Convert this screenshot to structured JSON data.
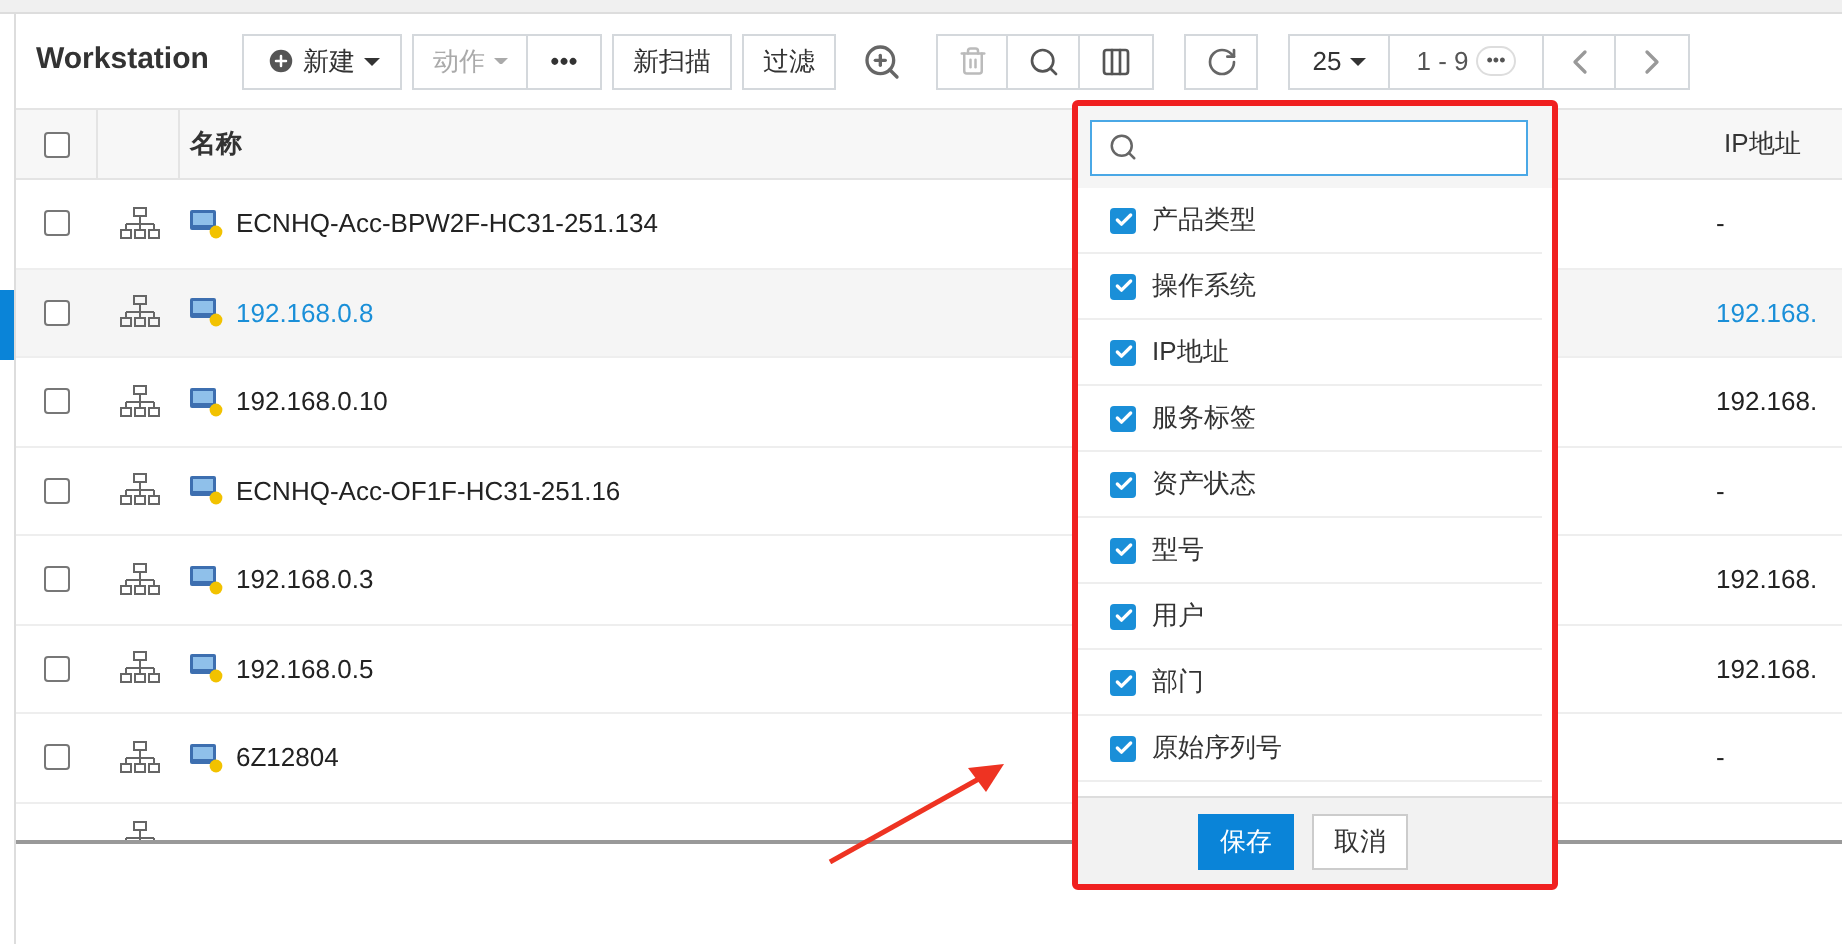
{
  "title": "Workstation",
  "toolbar": {
    "new_button": "新建",
    "action_button": {
      "label": "动作",
      "disabled": true
    },
    "more_button": "•••",
    "scan_button": "新扫描",
    "filter_button": "过滤",
    "delete_button": {
      "disabled": true
    },
    "page_size": "25",
    "range": "1 - 9",
    "range_more": "•••"
  },
  "table": {
    "select_all_checked": false,
    "columns": [
      "名称",
      "IP地址"
    ],
    "rows": [
      {
        "name": "ECNHQ-Acc-BPW2F-HC31-251.134",
        "ip": "-",
        "selected": false,
        "checked": false
      },
      {
        "name": "192.168.0.8",
        "ip": "192.168.",
        "selected": true,
        "checked": false
      },
      {
        "name": "192.168.0.10",
        "ip": "192.168.",
        "selected": false,
        "checked": false
      },
      {
        "name": "ECNHQ-Acc-OF1F-HC31-251.16",
        "ip": "-",
        "selected": false,
        "checked": false
      },
      {
        "name": "192.168.0.3",
        "ip": "192.168.",
        "selected": false,
        "checked": false
      },
      {
        "name": "192.168.0.5",
        "ip": "192.168.",
        "selected": false,
        "checked": false
      },
      {
        "name": "6Z12804",
        "ip": "-",
        "selected": false,
        "checked": false
      }
    ]
  },
  "column_picker": {
    "items": [
      {
        "label": "产品类型",
        "checked": true
      },
      {
        "label": "操作系统",
        "checked": true
      },
      {
        "label": "IP地址",
        "checked": true
      },
      {
        "label": "服务标签",
        "checked": true
      },
      {
        "label": "资产状态",
        "checked": true
      },
      {
        "label": "型号",
        "checked": true
      },
      {
        "label": "用户",
        "checked": true
      },
      {
        "label": "部门",
        "checked": true
      },
      {
        "label": "原始序列号",
        "checked": true
      }
    ],
    "save": "保存",
    "cancel": "取消"
  }
}
